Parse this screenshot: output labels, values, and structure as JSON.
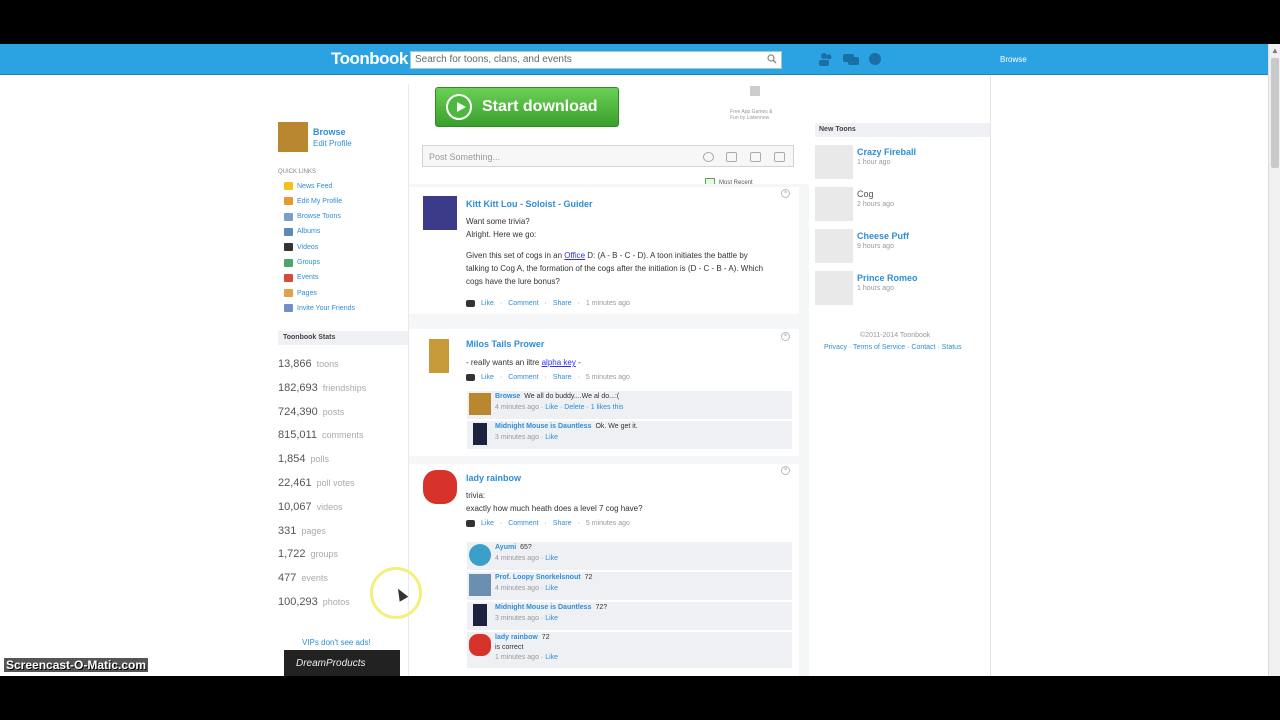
{
  "app": {
    "logo": "Toonbook",
    "username": "Browse"
  },
  "search": {
    "placeholder": "Search for toons, clans, and events"
  },
  "profile": {
    "name": "Browse",
    "edit": "Edit Profile"
  },
  "quick_links": {
    "title": "QUICK LINKS",
    "items": [
      {
        "label": "News Feed",
        "color": "#f3c21b"
      },
      {
        "label": "Edit My Profile",
        "color": "#e49b2d"
      },
      {
        "label": "Browse Toons",
        "color": "#7aa0c8"
      },
      {
        "label": "Albums",
        "color": "#5a8ab5"
      },
      {
        "label": "Videos",
        "color": "#333333"
      },
      {
        "label": "Groups",
        "color": "#4aa66b"
      },
      {
        "label": "Events",
        "color": "#d64a3a"
      },
      {
        "label": "Pages",
        "color": "#e0a34a"
      },
      {
        "label": "Invite Your Friends",
        "color": "#6e8fc7"
      }
    ]
  },
  "stats": {
    "title": "Toonbook Stats",
    "rows": [
      {
        "value": "13,866",
        "label": "toons"
      },
      {
        "value": "182,693",
        "label": "friendships"
      },
      {
        "value": "724,390",
        "label": "posts"
      },
      {
        "value": "815,011",
        "label": "comments"
      },
      {
        "value": "1,854",
        "label": "polls"
      },
      {
        "value": "22,461",
        "label": "poll votes"
      },
      {
        "value": "10,067",
        "label": "videos"
      },
      {
        "value": "331",
        "label": "pages"
      },
      {
        "value": "1,722",
        "label": "groups"
      },
      {
        "value": "477",
        "label": "events"
      },
      {
        "value": "100,293",
        "label": "photos"
      }
    ]
  },
  "vip": "VIPs don't see ads!",
  "ad_left": "DreamProducts",
  "ad_top": {
    "button": "Start download",
    "info": "Free App Games & Fun by Listennow"
  },
  "post_box": {
    "placeholder": "Post Something..."
  },
  "most_recent": "Most Recent",
  "posts": [
    {
      "author": "Kitt Kitt Lou - Soloist - Guider",
      "lines": [
        "Want some trivia?",
        "Alright. Here we go:",
        "",
        "Given this set of cogs in an",
        "Office",
        "D: (A - B - C - D). A toon initiates the battle by talking to Cog A, the formation of the cogs after the initiation is (D - C - B - A). Which cogs have the lure bonus?"
      ],
      "actions": {
        "like": "Like",
        "comment": "Comment",
        "share": "Share",
        "time": "1 minutes ago"
      }
    },
    {
      "author": "Milos Tails Prower",
      "text_prefix": "- really wants an iltre",
      "link": "alpha key",
      "text_suffix": "-",
      "actions": {
        "like": "Like",
        "comment": "Comment",
        "share": "Share",
        "time": "5 minutes ago"
      },
      "comments": [
        {
          "name": "Browse",
          "text": "We all do buddy....We al do...:(",
          "meta": "4 minutes ago",
          "links": "Like · Delete · 1 likes this"
        },
        {
          "name": "Midnight Mouse is Dauntless",
          "text": "Ok. We get it.",
          "meta": "3 minutes ago",
          "links": "Like"
        }
      ]
    },
    {
      "author": "lady rainbow",
      "lines": [
        "trivia:",
        "exactly how much heath does a level 7 cog have?"
      ],
      "actions": {
        "like": "Like",
        "comment": "Comment",
        "share": "Share",
        "time": "5 minutes ago"
      },
      "comments": [
        {
          "name": "Ayumi",
          "text": "65?",
          "meta": "4 minutes ago",
          "links": "Like"
        },
        {
          "name": "Prof. Loopy Snorkelsnout",
          "text": "72",
          "meta": "4 minutes ago",
          "links": "Like"
        },
        {
          "name": "Midnight Mouse is Dauntless",
          "text": "72?",
          "meta": "3 minutes ago",
          "links": "Like"
        },
        {
          "name": "lady rainbow",
          "text": "72",
          "extra": "is correct",
          "meta": "1 minutes ago",
          "links": "Like"
        }
      ]
    }
  ],
  "new_toons": {
    "title": "New Toons",
    "items": [
      {
        "name": "Crazy Fireball",
        "time": "1 hour ago"
      },
      {
        "name": "Cog",
        "time": "2 hours ago"
      },
      {
        "name": "Cheese Puff",
        "time": "9 hours ago"
      },
      {
        "name": "Prince Romeo",
        "time": "1 hours ago"
      }
    ]
  },
  "footer": {
    "copyright": "©2011-2014 Toonbook",
    "links": "Privacy · Terms of Service · Contact · Status"
  },
  "watermark": "Screencast-O-Matic.com"
}
